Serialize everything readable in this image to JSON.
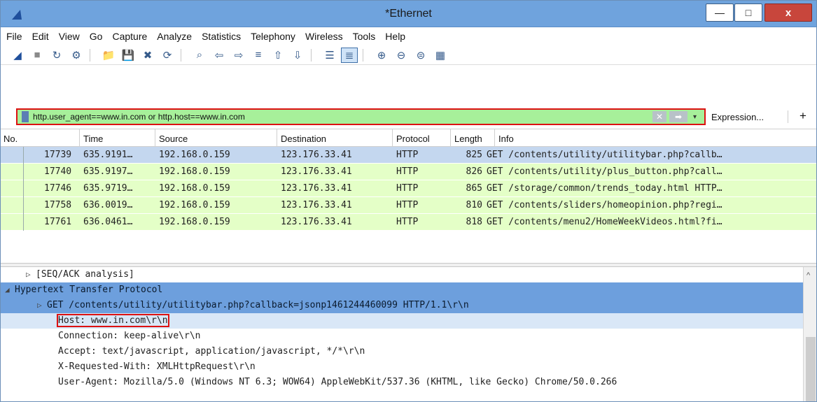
{
  "window": {
    "title": "*Ethernet",
    "close_label": "x",
    "min_label": "—",
    "max_label": "□"
  },
  "menu": [
    "File",
    "Edit",
    "View",
    "Go",
    "Capture",
    "Analyze",
    "Statistics",
    "Telephony",
    "Wireless",
    "Tools",
    "Help"
  ],
  "toolbar": [
    "shark-fin-start-icon",
    "stop-icon",
    "restart-icon",
    "options-gear-icon",
    "open-folder-icon",
    "save-icon",
    "close-file-icon",
    "reload-icon",
    "find-icon",
    "back-icon",
    "forward-icon",
    "goto-packet-icon",
    "first-packet-icon",
    "last-packet-icon",
    "autoscroll-icon",
    "colorize-icon",
    "zoom-in-icon",
    "zoom-out-icon",
    "normal-size-icon",
    "resize-columns-icon"
  ],
  "filter": {
    "value": "http.user_agent==www.in.com or http.host==www.in.com",
    "expression_label": "Expression...",
    "plus_label": "+",
    "clear_label": "✕",
    "apply_label": "➡",
    "dropdown_label": "▾"
  },
  "columns": [
    "No.",
    "Time",
    "Source",
    "Destination",
    "Protocol",
    "Length",
    "Info"
  ],
  "packets": [
    {
      "no": "17739",
      "time": "635.9191…",
      "src": "192.168.0.159",
      "dst": "123.176.33.41",
      "proto": "HTTP",
      "len": "825",
      "info": "GET /contents/utility/utilitybar.php?callb…"
    },
    {
      "no": "17740",
      "time": "635.9197…",
      "src": "192.168.0.159",
      "dst": "123.176.33.41",
      "proto": "HTTP",
      "len": "826",
      "info": "GET /contents/utility/plus_button.php?call…"
    },
    {
      "no": "17746",
      "time": "635.9719…",
      "src": "192.168.0.159",
      "dst": "123.176.33.41",
      "proto": "HTTP",
      "len": "865",
      "info": "GET /storage/common/trends_today.html HTTP…"
    },
    {
      "no": "17758",
      "time": "636.0019…",
      "src": "192.168.0.159",
      "dst": "123.176.33.41",
      "proto": "HTTP",
      "len": "810",
      "info": "GET /contents/sliders/homeopinion.php?regi…"
    },
    {
      "no": "17761",
      "time": "636.0461…",
      "src": "192.168.0.159",
      "dst": "123.176.33.41",
      "proto": "HTTP",
      "len": "818",
      "info": "GET /contents/menu2/HomeWeekVideos.html?fi…"
    }
  ],
  "details": [
    {
      "tri": "▷",
      "text": "[SEQ/ACK analysis]"
    },
    {
      "tri": "◢",
      "text": "Hypertext Transfer Protocol"
    },
    {
      "tri": "▷",
      "text": "GET /contents/utility/utilitybar.php?callback=jsonp1461244460099 HTTP/1.1\\r\\n"
    },
    {
      "tri": "",
      "text": "Host: www.in.com\\r\\n"
    },
    {
      "tri": "",
      "text": "Connection: keep-alive\\r\\n"
    },
    {
      "tri": "",
      "text": "Accept: text/javascript, application/javascript, */*\\r\\n"
    },
    {
      "tri": "",
      "text": "X-Requested-With: XMLHttpRequest\\r\\n"
    },
    {
      "tri": "",
      "text": "User-Agent: Mozilla/5.0 (Windows NT 6.3; WOW64) AppleWebKit/537.36 (KHTML, like Gecko) Chrome/50.0.266"
    }
  ],
  "colors": {
    "filter_bg": "#a7f09a",
    "highlight": "#d11111",
    "selected_row": "#c4d7ef",
    "http_row": "#e4ffc7",
    "titlebar": "#6fa3dd",
    "selected_detail": "#6d9fdd"
  }
}
